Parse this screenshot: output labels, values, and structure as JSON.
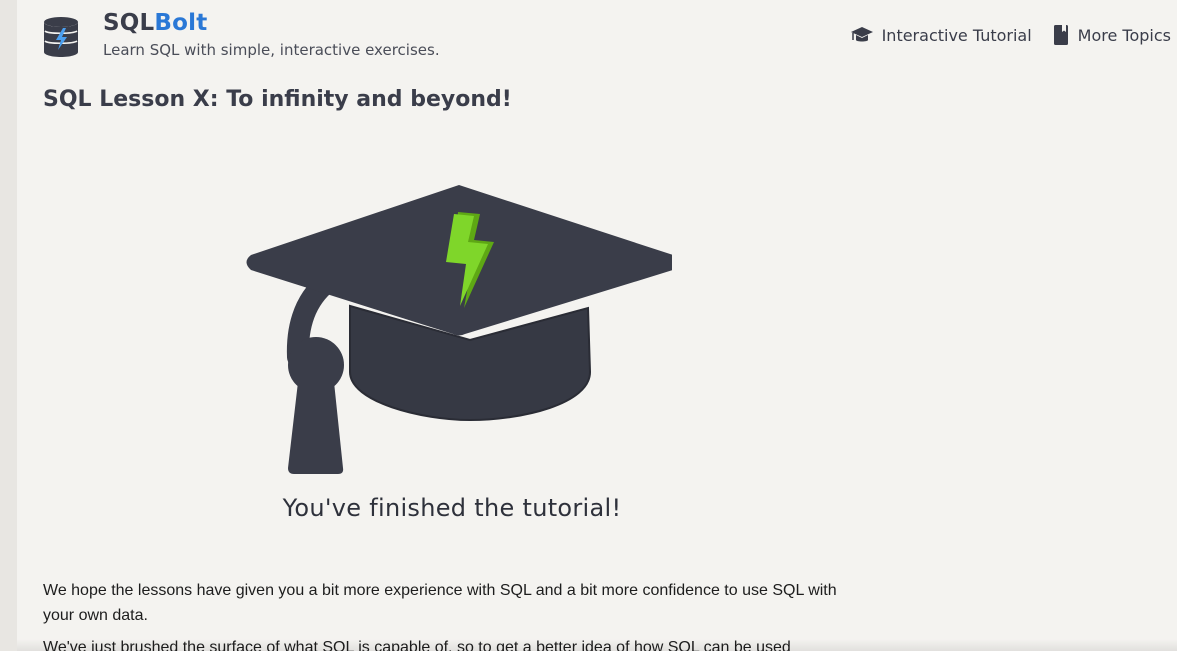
{
  "header": {
    "brand_sql": "SQL",
    "brand_bolt": "Bolt",
    "tagline": "Learn SQL with simple, interactive exercises."
  },
  "nav": {
    "items": [
      {
        "label": "Interactive Tutorial",
        "icon": "graduation-cap-icon"
      },
      {
        "label": "More Topics",
        "icon": "book-icon"
      }
    ]
  },
  "lesson": {
    "title": "SQL Lesson X: To infinity and beyond!",
    "finished_text": "You've finished the tutorial!",
    "paragraphs": [
      "We hope the lessons have given you a bit more experience with SQL and a bit more confidence to use SQL with your own data.",
      "We've just brushed the surface of what SQL is capable of, so to get a better idea of how SQL can be used"
    ]
  },
  "colors": {
    "brand_blue": "#2a78d6",
    "cap_dark": "#3a3d49",
    "bolt_green": "#7bd421",
    "page_bg": "#f4f3f0"
  }
}
